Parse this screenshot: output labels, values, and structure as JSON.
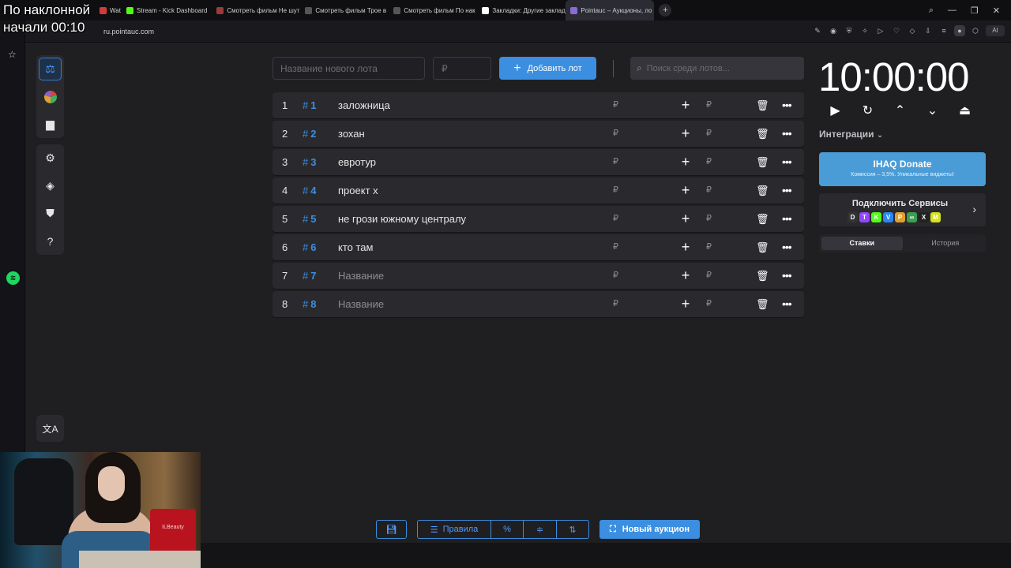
{
  "browser": {
    "tabs": [
      {
        "label": "Wat",
        "color": "#d23b3b",
        "active": false
      },
      {
        "label": "Stream - Kick Dashboard",
        "color": "#53fc18",
        "active": false
      },
      {
        "label": "Смотреть фильм Не шут",
        "color": "#9a3b3b",
        "active": false
      },
      {
        "label": "Смотреть фильм Трое в",
        "color": "#555",
        "active": false
      },
      {
        "label": "Смотреть фильм По нак",
        "color": "#555",
        "active": false
      },
      {
        "label": "Закладки: Другие заклад",
        "color": "#ffffff",
        "active": false
      },
      {
        "label": "Pointauc – Аукционы, ло",
        "color": "#8a6bd6",
        "active": true
      }
    ],
    "url": "ru.pointauc.com",
    "ai_label": "AI"
  },
  "overlay": {
    "line1": "По наклонной",
    "line2": "начали 00:10"
  },
  "form": {
    "name_placeholder": "Название нового лота",
    "price_placeholder": "₽",
    "add_button": "Добавить лот",
    "search_placeholder": "Поиск среди лотов..."
  },
  "lots": [
    {
      "num": "1",
      "id": "1",
      "name": "заложница",
      "placeholder": false
    },
    {
      "num": "2",
      "id": "2",
      "name": "зохан",
      "placeholder": false
    },
    {
      "num": "3",
      "id": "3",
      "name": "евротур",
      "placeholder": false
    },
    {
      "num": "4",
      "id": "4",
      "name": "проект х",
      "placeholder": false
    },
    {
      "num": "5",
      "id": "5",
      "name": "не грози южному централу",
      "placeholder": false
    },
    {
      "num": "6",
      "id": "6",
      "name": "кто там",
      "placeholder": false
    },
    {
      "num": "7",
      "id": "7",
      "name": "Название",
      "placeholder": true
    },
    {
      "num": "8",
      "id": "8",
      "name": "Название",
      "placeholder": true
    }
  ],
  "currency": "₽",
  "timer": "10:00:00",
  "integrations_label": "Интеграции",
  "donate": {
    "title": "IHAQ Donate",
    "subtitle": "Комиссия – 3,5%. Уникальные виджеты!"
  },
  "connect": {
    "title": "Подключить Сервисы",
    "services": [
      {
        "name": "donationalerts",
        "glyph": "D",
        "color": "#333"
      },
      {
        "name": "twitch",
        "glyph": "T",
        "color": "#9146ff"
      },
      {
        "name": "kick",
        "glyph": "K",
        "color": "#53fc18"
      },
      {
        "name": "vk",
        "glyph": "V",
        "color": "#2787f5"
      },
      {
        "name": "donatepay",
        "glyph": "P",
        "color": "#e0a030"
      },
      {
        "name": "boosty",
        "glyph": "∞",
        "color": "#3aa050"
      },
      {
        "name": "x",
        "glyph": "X",
        "color": "#222"
      },
      {
        "name": "memealerts",
        "glyph": "M",
        "color": "#d6e21e"
      }
    ]
  },
  "bids_tabs": {
    "active": "Ставки",
    "other": "История"
  },
  "bottom": {
    "rules_label": "Правила",
    "new_auction_label": "Новый аукцион"
  },
  "webcam": {
    "bag_text": "ILBeauty"
  },
  "colors": {
    "accent": "#3b8ee0",
    "background": "#1f1f22",
    "row": "#2a2a2e"
  }
}
